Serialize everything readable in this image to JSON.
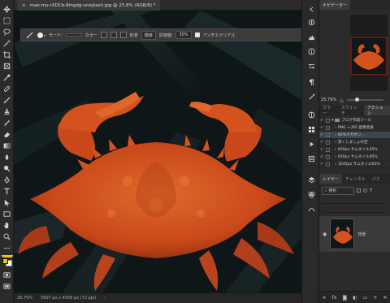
{
  "document": {
    "tab_title": "mae-mu-rXDCb-8mgdg-unsplash.jpg @ 25.8% (RGB/8) *",
    "close_glyph": "×"
  },
  "options_bar": {
    "mode_label": "モード:",
    "color_label": "カラー",
    "size_label": "形状",
    "pattern_label": "模様",
    "tolerance_label": "許容値:",
    "tolerance_value": "30%",
    "antialias_label": "アンチエイリアス"
  },
  "status_bar": {
    "zoom": "25.79%",
    "doc_info": "5607 px x 4509 px (72 ppi)"
  },
  "navigator": {
    "tab_label": "ナビゲーター",
    "zoom": "25.79%"
  },
  "actions_panel": {
    "tabs": [
      "カラー",
      "スウォッチ",
      "アクション"
    ],
    "active_tab": "アクション",
    "items": [
      {
        "label": "ブログ作成ツール",
        "checked": true,
        "folder": true
      },
      {
        "label": "PNG → JPG 画像変換",
        "checked": true,
        "folder": false
      },
      {
        "label": "60%ネガポジ...",
        "checked": true,
        "folder": false
      },
      {
        "label": "黒くしましょの空",
        "checked": true,
        "folder": false
      },
      {
        "label": "600px サムネイル65%",
        "checked": true,
        "folder": false
      },
      {
        "label": "600px サムネイル65%",
        "checked": true,
        "folder": false
      },
      {
        "label": "1640px サムネイル65%",
        "checked": true,
        "folder": false
      }
    ]
  },
  "layers_panel": {
    "tabs": [
      "レイヤー",
      "チャンネル",
      "パス"
    ],
    "active_tab": "レイヤー",
    "search_label": "種類",
    "layer_name": "背景"
  },
  "colors": {
    "foreground": "#f2c11d",
    "background": "#ffffff",
    "crab": "#d4521e"
  }
}
